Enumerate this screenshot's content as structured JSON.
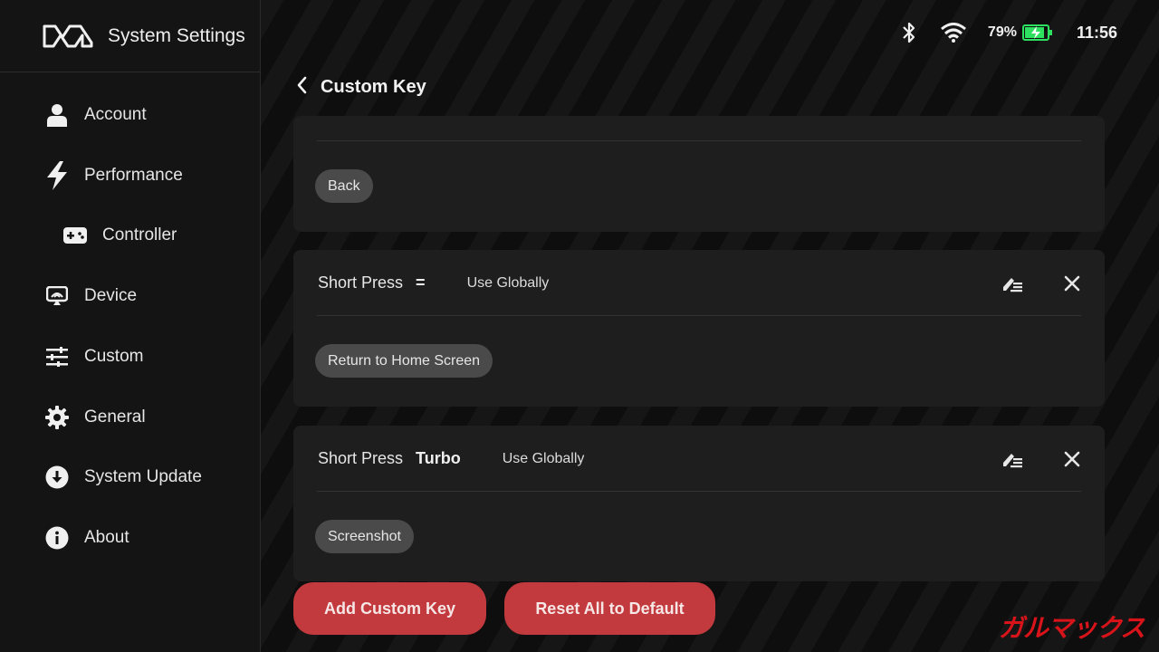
{
  "app": {
    "title": "System Settings"
  },
  "status": {
    "battery": "79%",
    "time": "11:56"
  },
  "sidebar": {
    "items": [
      {
        "label": "Account",
        "icon": "person-icon"
      },
      {
        "label": "Performance",
        "icon": "lightning-icon"
      },
      {
        "label": "Controller",
        "icon": "gamepad-icon"
      },
      {
        "label": "Device",
        "icon": "device-icon"
      },
      {
        "label": "Custom",
        "icon": "sliders-icon"
      },
      {
        "label": "General",
        "icon": "gear-icon"
      },
      {
        "label": "System Update",
        "icon": "download-icon"
      },
      {
        "label": "About",
        "icon": "info-icon"
      }
    ]
  },
  "page": {
    "title": "Custom Key"
  },
  "cards": [
    {
      "action": "Back"
    },
    {
      "press": "Short Press",
      "key": "=",
      "scope": "Use Globally",
      "action": "Return to Home Screen"
    },
    {
      "press": "Short Press",
      "key": "Turbo",
      "scope": "Use Globally",
      "action": "Screenshot"
    }
  ],
  "buttons": {
    "add": "Add Custom Key",
    "reset": "Reset All to Default"
  },
  "watermark": "ガルマックス",
  "colors": {
    "accent": "#c23a3d",
    "card": "#1e1e1e",
    "chip": "#4a4a4a",
    "battery": "#2ee060"
  }
}
